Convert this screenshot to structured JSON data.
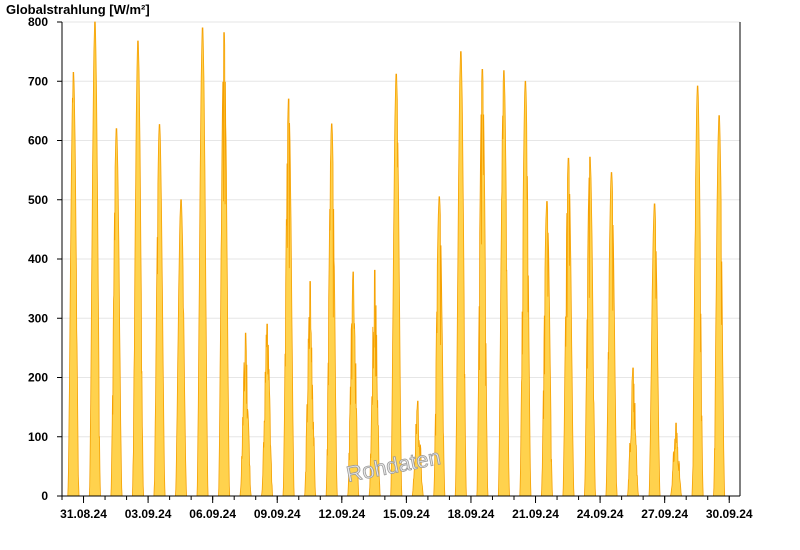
{
  "chart_data": {
    "type": "area",
    "title": "Globalstrahlung [W/m²]",
    "xlabel": "",
    "ylabel": "",
    "x_range": [
      "2024-08-30",
      "2024-09-30T12:00"
    ],
    "ylim": [
      0,
      800
    ],
    "y_ticks": [
      0,
      100,
      200,
      300,
      400,
      500,
      600,
      700,
      800
    ],
    "x_tick_labels": [
      "31.08.24",
      "03.09.24",
      "06.09.24",
      "09.09.24",
      "12.09.24",
      "15.09.24",
      "18.09.24",
      "21.09.24",
      "24.09.24",
      "27.09.24",
      "30.09.24"
    ],
    "grid": "horizontal",
    "fill_color": "#FFD24D",
    "line_color": "#F5A000",
    "series": [
      {
        "values": [
          {
            "date": "2024-08-30",
            "peak": 715
          },
          {
            "date": "2024-08-31",
            "peak": 800
          },
          {
            "date": "2024-09-01",
            "peak": 620
          },
          {
            "date": "2024-09-02",
            "peak": 768
          },
          {
            "date": "2024-09-03",
            "peak": 627
          },
          {
            "date": "2024-09-04",
            "peak": 500
          },
          {
            "date": "2024-09-05",
            "peak": 790
          },
          {
            "date": "2024-09-06",
            "peak": 782
          },
          {
            "date": "2024-09-07",
            "peak": 275
          },
          {
            "date": "2024-09-08",
            "peak": 290
          },
          {
            "date": "2024-09-09",
            "peak": 670
          },
          {
            "date": "2024-09-10",
            "peak": 362
          },
          {
            "date": "2024-09-11",
            "peak": 628
          },
          {
            "date": "2024-09-12",
            "peak": 378
          },
          {
            "date": "2024-09-13",
            "peak": 381
          },
          {
            "date": "2024-09-14",
            "peak": 712
          },
          {
            "date": "2024-09-15",
            "peak": 160
          },
          {
            "date": "2024-09-16",
            "peak": 505
          },
          {
            "date": "2024-09-17",
            "peak": 750
          },
          {
            "date": "2024-09-18",
            "peak": 720
          },
          {
            "date": "2024-09-19",
            "peak": 718
          },
          {
            "date": "2024-09-20",
            "peak": 700
          },
          {
            "date": "2024-09-21",
            "peak": 497
          },
          {
            "date": "2024-09-22",
            "peak": 570
          },
          {
            "date": "2024-09-23",
            "peak": 572
          },
          {
            "date": "2024-09-24",
            "peak": 546
          },
          {
            "date": "2024-09-25",
            "peak": 216
          },
          {
            "date": "2024-09-26",
            "peak": 493
          },
          {
            "date": "2024-09-27",
            "peak": 123
          },
          {
            "date": "2024-09-28",
            "peak": 692
          },
          {
            "date": "2024-09-29",
            "peak": 642
          }
        ]
      }
    ],
    "watermark": "Rohdaten"
  }
}
